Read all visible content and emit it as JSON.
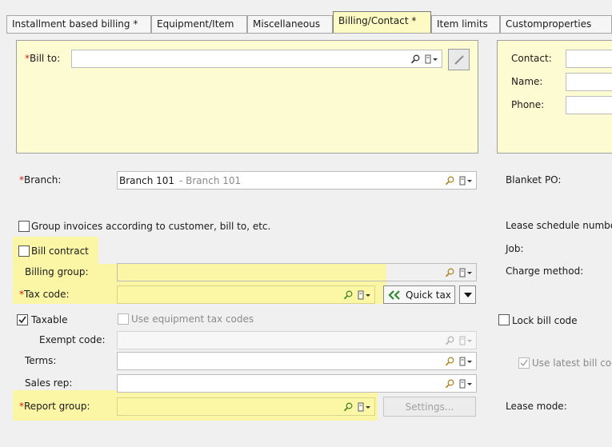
{
  "tabs": [
    {
      "label": "Installment based billing *"
    },
    {
      "label": "Equipment/Item"
    },
    {
      "label": "Miscellaneous"
    },
    {
      "label": "Billing/Contact *"
    },
    {
      "label": "Item limits"
    },
    {
      "label": "Customproperties"
    }
  ],
  "bill_to": {
    "label": "Bill to:",
    "required_mark": "*",
    "value": ""
  },
  "contact_panel": {
    "contact_label": "Contact:",
    "name_label": "Name:",
    "phone_label": "Phone:"
  },
  "branch": {
    "label": "Branch:",
    "required_mark": "*",
    "value": "Branch 101",
    "value_description": "- Branch 101"
  },
  "blanket_po_label": "Blanket PO:",
  "group_invoices": {
    "label": "Group invoices according to customer, bill to, etc.",
    "checked": false
  },
  "lease_schedule_label": "Lease schedule numbe",
  "bill_contract": {
    "label": "Bill contract",
    "checked": false
  },
  "job_label": "Job:",
  "billing_group": {
    "label": "Billing group:",
    "value": ""
  },
  "charge_method_label": "Charge method:",
  "tax_code": {
    "label": "Tax code:",
    "required_mark": "*",
    "value": ""
  },
  "quick_tax": {
    "label": "Quick tax"
  },
  "taxable": {
    "label": "Taxable",
    "checked": true
  },
  "use_equipment_tax_codes": {
    "label": "Use equipment tax codes",
    "checked": false
  },
  "lock_bill_code": {
    "label": "Lock bill code",
    "checked": false
  },
  "exempt_code": {
    "label": "Exempt code:",
    "value": ""
  },
  "terms": {
    "label": "Terms:",
    "value": ""
  },
  "use_latest_bill_code": {
    "label": "Use latest bill coc",
    "checked": true
  },
  "sales_rep": {
    "label": "Sales rep:",
    "value": ""
  },
  "report_group": {
    "label": "Report group:",
    "required_mark": "*",
    "value": ""
  },
  "settings_button": {
    "label": "Settings..."
  },
  "lease_mode_label": "Lease mode:",
  "colors": {
    "highlight": "#fbf6a6",
    "panel": "#fdfbd2",
    "required": "#d11a1a",
    "accent_green": "#2e8b2e"
  }
}
